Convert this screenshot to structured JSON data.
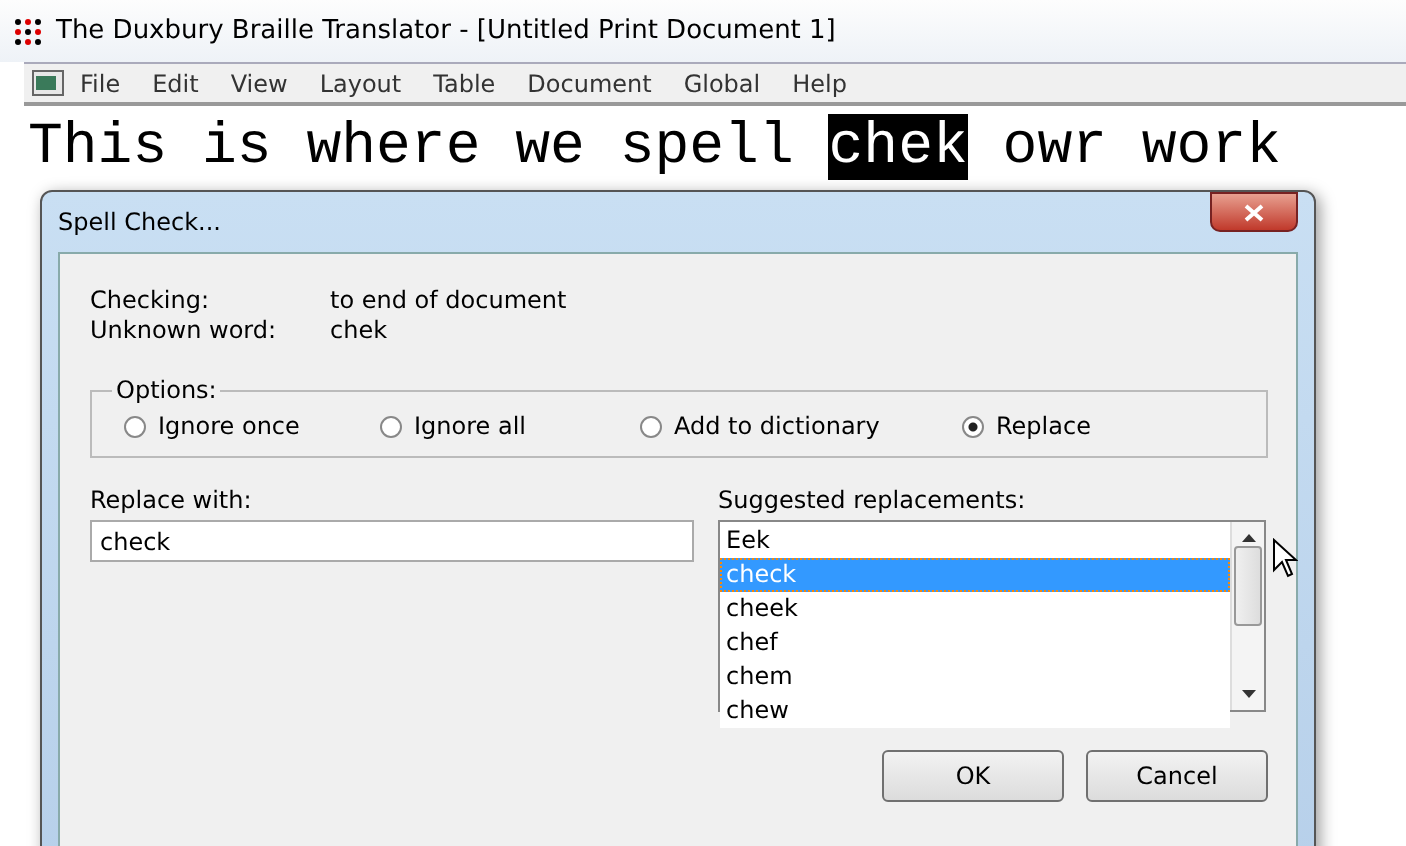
{
  "window": {
    "title": "The Duxbury Braille Translator - [Untitled Print Document 1]"
  },
  "menu": [
    "File",
    "Edit",
    "View",
    "Layout",
    "Table",
    "Document",
    "Global",
    "Help"
  ],
  "document": {
    "segments": [
      {
        "text": "This is where we spell ",
        "selected": false
      },
      {
        "text": "chek",
        "selected": true
      },
      {
        "text": " owr work",
        "selected": false
      }
    ]
  },
  "dialog": {
    "title": "Spell Check...",
    "info": [
      {
        "label": "Checking:",
        "value": "to end of document"
      },
      {
        "label": "Unknown word:",
        "value": "chek"
      }
    ],
    "options": {
      "legend": "Options:",
      "items": [
        {
          "label": "Ignore once",
          "selected": false
        },
        {
          "label": "Ignore all",
          "selected": false
        },
        {
          "label": "Add to dictionary",
          "selected": false
        },
        {
          "label": "Replace",
          "selected": true
        }
      ]
    },
    "replace_with": {
      "label": "Replace with:",
      "value": "check"
    },
    "suggestions": {
      "label": "Suggested replacements:",
      "items": [
        {
          "text": "Eek",
          "selected": false
        },
        {
          "text": "check",
          "selected": true
        },
        {
          "text": "cheek",
          "selected": false
        },
        {
          "text": "chef",
          "selected": false
        },
        {
          "text": "chem",
          "selected": false
        },
        {
          "text": "chew",
          "selected": false
        }
      ]
    },
    "buttons": [
      "OK",
      "Cancel"
    ]
  }
}
